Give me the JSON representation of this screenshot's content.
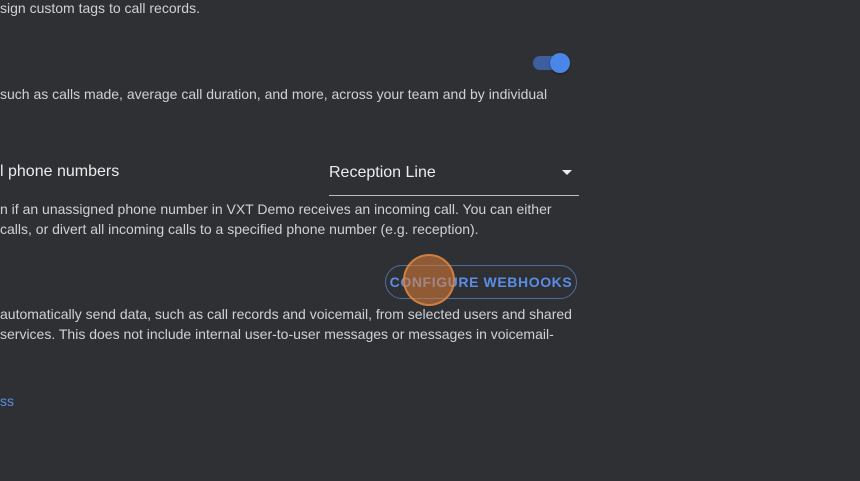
{
  "tags_section": {
    "description": "sign custom tags to call records."
  },
  "analytics_section": {
    "toggle_on": true,
    "description": "such as calls made, average call duration, and more, across your team and by individual"
  },
  "phone_numbers_section": {
    "title": "l phone numbers",
    "select_value": "Reception Line",
    "description_line1": "n if an unassigned phone number in VXT Demo receives an incoming call. You can either",
    "description_line2": "calls, or divert all incoming calls to a specified phone number (e.g. reception)."
  },
  "webhooks_section": {
    "button_label": "CONFIGURE WEBHOOKS",
    "description_line1": "automatically send data, such as call records and voicemail, from selected users and shared",
    "description_line2": "services. This does not include internal user-to-user messages or messages in voicemail-"
  },
  "footer_link": {
    "label": "ss"
  },
  "colors": {
    "background": "#2f3034",
    "accent": "#5b8de6",
    "toggle_thumb": "#4a86e8"
  }
}
